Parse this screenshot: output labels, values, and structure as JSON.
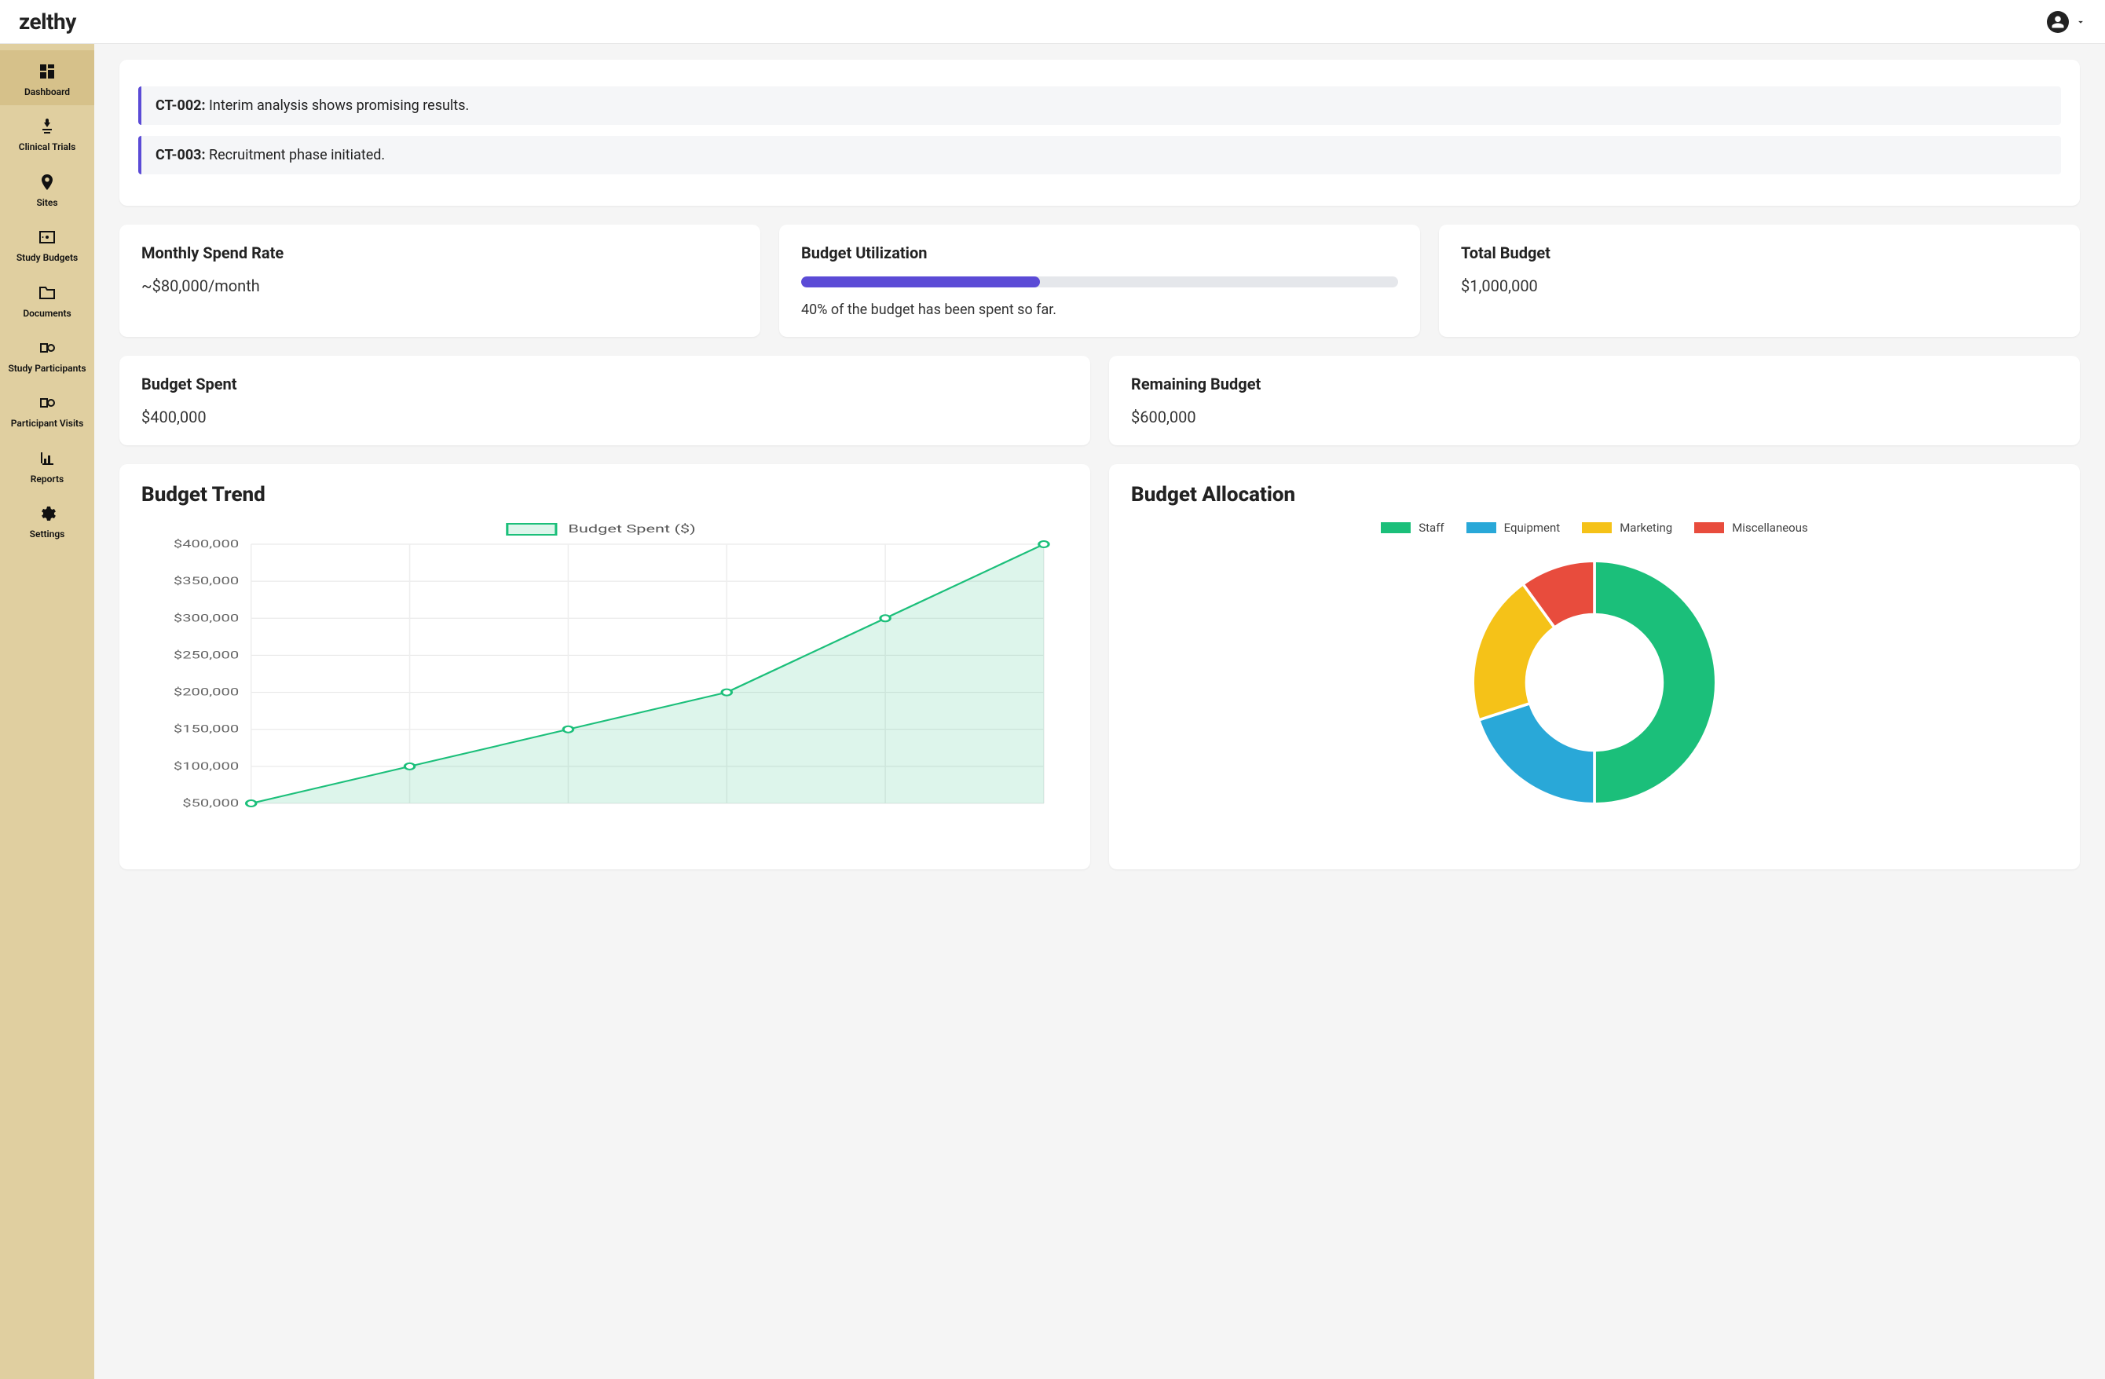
{
  "brand": "zelthy",
  "sidebar": {
    "items": [
      {
        "label": "Dashboard",
        "icon": "dashboard-icon",
        "active": true
      },
      {
        "label": "Clinical Trials",
        "icon": "trials-icon",
        "active": false
      },
      {
        "label": "Sites",
        "icon": "location-icon",
        "active": false
      },
      {
        "label": "Study Budgets",
        "icon": "money-icon",
        "active": false
      },
      {
        "label": "Documents",
        "icon": "folder-icon",
        "active": false
      },
      {
        "label": "Study Participants",
        "icon": "participants-icon",
        "active": false
      },
      {
        "label": "Participant Visits",
        "icon": "visits-icon",
        "active": false
      },
      {
        "label": "Reports",
        "icon": "barchart-icon",
        "active": false
      },
      {
        "label": "Settings",
        "icon": "gear-icon",
        "active": false
      }
    ]
  },
  "alerts": [
    {
      "id": "CT-002:",
      "text": "Interim analysis shows promising results."
    },
    {
      "id": "CT-003:",
      "text": "Recruitment phase initiated."
    }
  ],
  "stats": {
    "monthlySpend": {
      "title": "Monthly Spend Rate",
      "value": "~$80,000/month"
    },
    "utilization": {
      "title": "Budget Utilization",
      "percent": 40,
      "caption": "40% of the budget has been spent so far."
    },
    "totalBudget": {
      "title": "Total Budget",
      "value": "$1,000,000"
    },
    "budgetSpent": {
      "title": "Budget Spent",
      "value": "$400,000"
    },
    "remaining": {
      "title": "Remaining Budget",
      "value": "$600,000"
    }
  },
  "charts": {
    "trend": {
      "title": "Budget Trend",
      "legend": "Budget Spent ($)"
    },
    "allocation": {
      "title": "Budget Allocation"
    }
  },
  "chart_data": [
    {
      "id": "budget_trend",
      "type": "line",
      "title": "Budget Trend",
      "series_name": "Budget Spent ($)",
      "x": [
        1,
        2,
        3,
        4,
        5,
        6
      ],
      "values": [
        50000,
        100000,
        150000,
        200000,
        300000,
        400000
      ],
      "ylim": [
        50000,
        400000
      ],
      "ytick_labels": [
        "$50,000",
        "$100,000",
        "$150,000",
        "$200,000",
        "$250,000",
        "$300,000",
        "$350,000",
        "$400,000"
      ],
      "yticks": [
        50000,
        100000,
        150000,
        200000,
        250000,
        300000,
        350000,
        400000
      ]
    },
    {
      "id": "budget_allocation",
      "type": "pie",
      "title": "Budget Allocation",
      "series": [
        {
          "name": "Staff",
          "value": 50,
          "color": "#1BBF7A"
        },
        {
          "name": "Equipment",
          "value": 20,
          "color": "#29A8D8"
        },
        {
          "name": "Marketing",
          "value": 20,
          "color": "#F5C218"
        },
        {
          "name": "Miscellaneous",
          "value": 10,
          "color": "#E84C3D"
        }
      ]
    }
  ]
}
